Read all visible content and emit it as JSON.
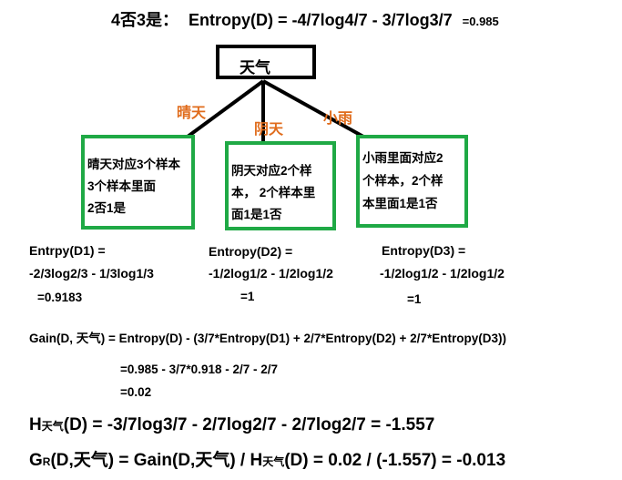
{
  "colors": {
    "branch_label": "#e06c1c",
    "box_border": "#1fa945",
    "text": "#000000"
  },
  "header": {
    "prefix": "4否3是：",
    "formula": "Entropy(D) = -4/7log4/7 - 3/7log3/7",
    "result": "=0.985"
  },
  "tree": {
    "root": "天气",
    "branches": [
      {
        "label": "晴天",
        "box_lines": [
          "晴天对应3个样本",
          "3个样本里面",
          "2否1是"
        ]
      },
      {
        "label": "阴天",
        "box_lines": [
          "阴天对应2个样",
          "本，  2个样本里",
          "面1是1否"
        ]
      },
      {
        "label": "小雨",
        "box_lines": [
          "小雨里面对应2",
          "个样本，2个样",
          "本里面1是1否"
        ]
      }
    ]
  },
  "entropies": [
    {
      "name": "Entrpy(D1) =",
      "expr": "-2/3log2/3 - 1/3log1/3",
      "value": "=0.9183"
    },
    {
      "name": "Entropy(D2) =",
      "expr": "-1/2log1/2 - 1/2log1/2",
      "value": "=1"
    },
    {
      "name": "Entropy(D3) =",
      "expr": "-1/2log1/2 - 1/2log1/2",
      "value": "=1"
    }
  ],
  "gain": {
    "line1": "Gain(D, 天气) = Entropy(D) - (3/7*Entropy(D1) + 2/7*Entropy(D2) + 2/7*Entropy(D3))",
    "line2": "=0.985 - 3/7*0.918 - 2/7 - 2/7",
    "line3": "=0.02"
  },
  "h": {
    "H": "H",
    "sub": "天气",
    "rest": "(D) = -3/7log3/7 - 2/7log2/7 - 2/7log2/7 = -1.557"
  },
  "gr": {
    "G": "G",
    "sub": "R",
    "mid": "(D,天气) = Gain(D,天气) / H",
    "sub2": "天气",
    "rest": "(D) = 0.02 / (-1.557) = -0.013"
  }
}
